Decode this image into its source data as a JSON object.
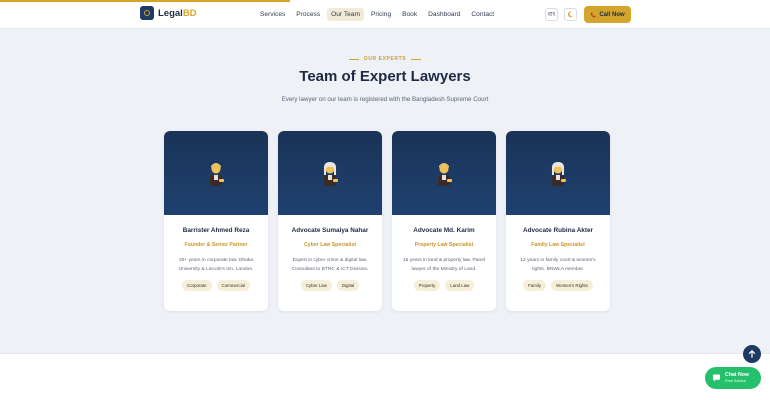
{
  "header": {
    "logo_main": "Legal",
    "logo_accent": "BD",
    "nav": [
      {
        "label": "Services"
      },
      {
        "label": "Process"
      },
      {
        "label": "Our Team"
      },
      {
        "label": "Pricing"
      },
      {
        "label": "Book"
      },
      {
        "label": "Dashboard"
      },
      {
        "label": "Contact"
      }
    ],
    "active_nav": "Our Team",
    "lang_label": "বাং",
    "theme_icon": "moon-icon",
    "call_label": "Call Now",
    "accent_color": "#d4a52c",
    "brand_color": "#1f3a63"
  },
  "section": {
    "eyebrow": "OUR EXPERTS",
    "title": "Team of Expert Lawyers",
    "subtitle": "Every lawyer on our team is registered with the Bangladesh Supreme Court"
  },
  "team": [
    {
      "avatar_icon": "judge-man-icon",
      "name": "Barrister Ahmed Reza",
      "role": "Founder & Senior Partner",
      "desc": "20+ years in corporate law. Dhaka University & Lincoln's Inn, London.",
      "tags": [
        "Corporate",
        "Commercial"
      ]
    },
    {
      "avatar_icon": "judge-woman-icon",
      "name": "Advocate Sumaiya Nahar",
      "role": "Cyber Law Specialist",
      "desc": "Expert in cyber crime & digital law. Consultant to BTRC & ICT Division.",
      "tags": [
        "Cyber Law",
        "Digital"
      ]
    },
    {
      "avatar_icon": "judge-man-icon",
      "name": "Advocate Md. Karim",
      "role": "Property Law Specialist",
      "desc": "15 years in land & property law. Panel lawyer of the Ministry of Land.",
      "tags": [
        "Property",
        "Land Law"
      ]
    },
    {
      "avatar_icon": "judge-woman-icon",
      "name": "Advocate Rubina Akter",
      "role": "Family Law Specialist",
      "desc": "12 years in family court & women's rights. BNWLA member.",
      "tags": [
        "Family",
        "Women's Rights"
      ]
    }
  ],
  "widgets": {
    "scroll_top_icon": "arrow-up-icon",
    "chat_title": "Chat Now",
    "chat_sub": "Free Advice",
    "chat_color": "#25c06b"
  }
}
